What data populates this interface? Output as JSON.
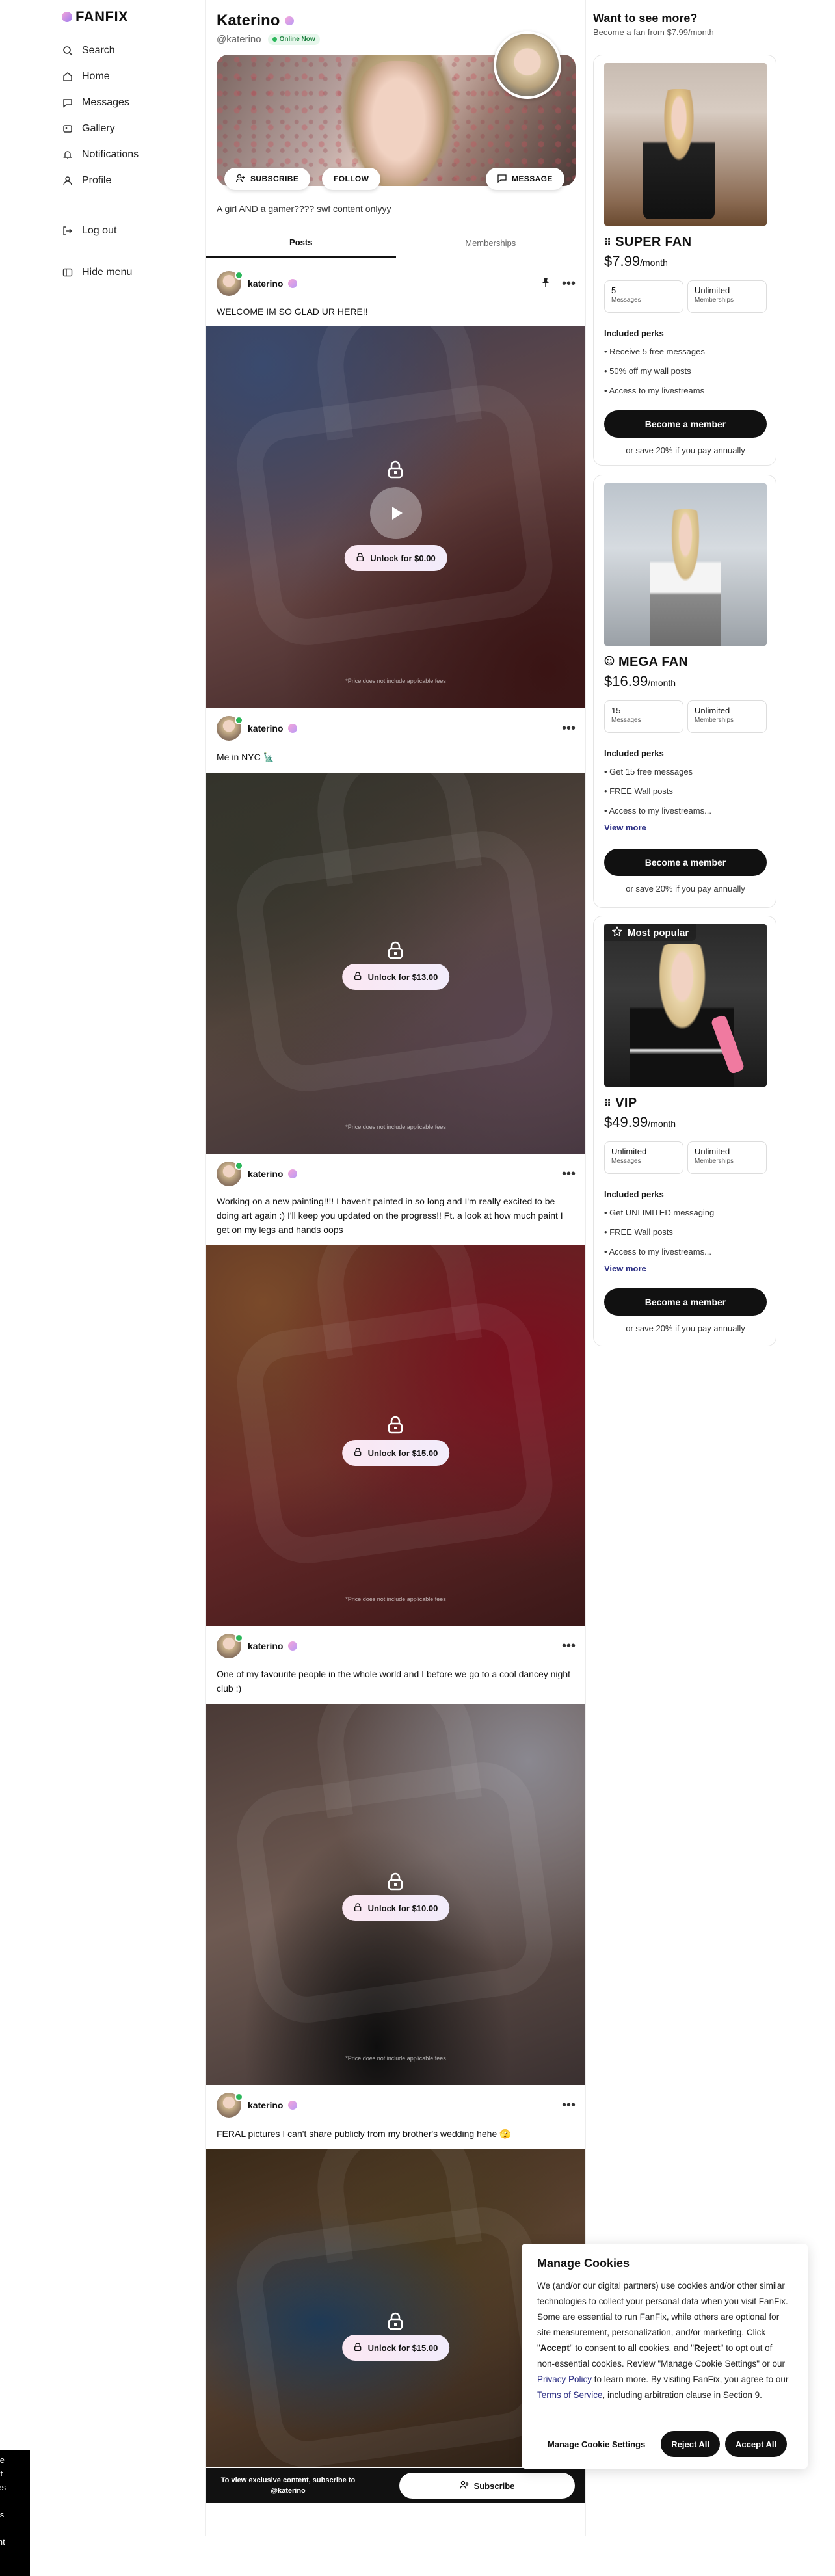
{
  "brand": {
    "name": "FANFIX"
  },
  "nav": {
    "items": [
      {
        "label": "Search"
      },
      {
        "label": "Home"
      },
      {
        "label": "Messages"
      },
      {
        "label": "Gallery"
      },
      {
        "label": "Notifications"
      },
      {
        "label": "Profile"
      }
    ],
    "logout": "Log out",
    "hide_menu": "Hide menu"
  },
  "profile": {
    "name": "Katerino",
    "handle": "@katerino",
    "status": "Online Now",
    "bio": "A girl AND a gamer???? swf content onlyyy",
    "buttons": {
      "subscribe": "SUBSCRIBE",
      "follow": "FOLLOW",
      "message": "MESSAGE"
    }
  },
  "tabs": [
    {
      "label": "Posts"
    },
    {
      "label": "Memberships"
    }
  ],
  "posts": [
    {
      "author": "katerino",
      "text": "WELCOME IM SO GLAD UR HERE!!",
      "unlock": "Unlock for $0.00",
      "fee": "*Price does not include applicable fees"
    },
    {
      "author": "katerino",
      "text": "Me in NYC 🗽",
      "unlock": "Unlock for $13.00",
      "fee": "*Price does not include applicable fees"
    },
    {
      "author": "katerino",
      "text": "Working on a new painting!!!! I haven't painted in so long and I'm really excited to be doing art again :) I'll keep you updated on the progress!! Ft. a look at how much paint I get on my legs and hands oops",
      "unlock": "Unlock for $15.00",
      "fee": "*Price does not include applicable fees"
    },
    {
      "author": "katerino",
      "text": "One of my favourite people in the whole world and I before we go to a cool dancey night club :)",
      "unlock": "Unlock for $10.00",
      "fee": "*Price does not include applicable fees"
    },
    {
      "author": "katerino",
      "text": "FERAL pictures I can't share publicly from my brother's wedding hehe 🫣",
      "unlock": "Unlock for $15.00",
      "fee": ""
    }
  ],
  "subscribe_bar": {
    "text": "To view exclusive content, subscribe to @katerino",
    "button": "Subscribe"
  },
  "memberships": {
    "title": "Want to see more?",
    "subtitle": "Become a fan from $7.99/month",
    "tiers": [
      {
        "name": "SUPER FAN",
        "price": "$7.99",
        "period": "/month",
        "stat1_value": "5",
        "stat1_label": "Messages",
        "stat2_value": "Unlimited",
        "stat2_label": "Memberships",
        "perks_title": "Included perks",
        "perks": [
          "• Receive 5 free messages",
          "• 50% off my wall posts",
          "• Access to my livestreams"
        ],
        "view_more": "",
        "button": "Become a member",
        "save": "or save 20% if you pay annually"
      },
      {
        "name": "MEGA FAN",
        "price": "$16.99",
        "period": "/month",
        "stat1_value": "15",
        "stat1_label": "Messages",
        "stat2_value": "Unlimited",
        "stat2_label": "Memberships",
        "perks_title": "Included perks",
        "perks": [
          "• Get 15 free messages",
          "• FREE Wall posts",
          "• Access to my livestreams..."
        ],
        "view_more": "View more",
        "button": "Become a member",
        "save": "or save 20% if you pay annually"
      },
      {
        "name": "VIP",
        "price": "$49.99",
        "period": "/month",
        "badge": "Most popular",
        "stat1_value": "Unlimited",
        "stat1_label": "Messages",
        "stat2_value": "Unlimited",
        "stat2_label": "Memberships",
        "perks_title": "Included perks",
        "perks": [
          "• Get UNLIMITED messaging",
          "• FREE Wall posts",
          "• Access to my livestreams..."
        ],
        "view_more": "View more",
        "button": "Become a member",
        "save": "or save 20% if you pay annually"
      }
    ]
  },
  "cookies": {
    "title": "Manage Cookies",
    "body_1": "We (and/or our digital partners) use cookies and/or other similar technologies to collect your personal data when you visit FanFix. Some are essential to run FanFix, while others are optional for site measurement, personalization, and/or marketing.  Click \"",
    "accept_word": "Accept",
    "body_2": "\" to consent to all cookies, and \"",
    "reject_word": "Reject",
    "body_3": "\" to opt out of non-essential cookies.  Review \"Manage Cookie Settings\" or our ",
    "privacy_link": "Privacy Policy",
    "body_4": " to learn more.  By visiting FanFix, you agree to our ",
    "terms_link": "Terms of Service",
    "body_5": ", including arbitration clause in Section 9.",
    "buttons": {
      "settings": "Manage Cookie Settings",
      "reject": "Reject All",
      "accept": "Accept All"
    }
  },
  "edge_fragments": [
    "ase",
    "ept",
    "kies",
    "o",
    "ess",
    "is",
    "tent"
  ],
  "colors": {
    "accent_gradient_start": "#f7a6d8",
    "accent_gradient_end": "#9b7bf0",
    "online": "#2bb75a",
    "link": "#2b2e83"
  }
}
